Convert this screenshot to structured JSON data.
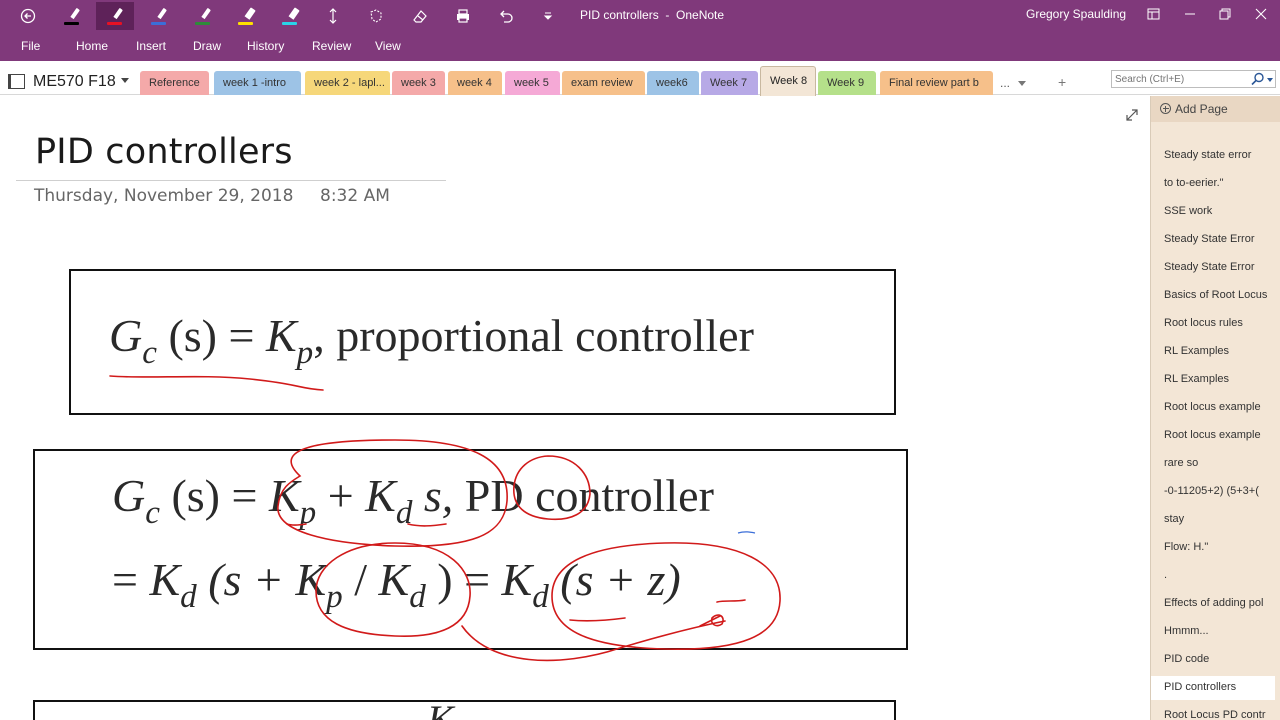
{
  "titlebar": {
    "window_title": "PID controllers  -  OneNote",
    "user_name": "Gregory Spaulding",
    "pen_colors": [
      "#000000",
      "#e81123",
      "#3b6ed8",
      "#2e8b3a",
      "#ffe000",
      "#2ad3e8"
    ],
    "icons": [
      "back-icon",
      "pen-black-icon",
      "pen-red-icon",
      "pen-blue-icon",
      "pen-green-icon",
      "highlighter-yellow-icon",
      "highlighter-cyan-icon",
      "add-space-icon",
      "lasso-select-icon",
      "eraser-icon",
      "print-icon",
      "undo-icon",
      "customize-toolbar-icon"
    ],
    "window_controls": [
      "full-screen-icon",
      "minimize-icon",
      "restore-icon",
      "close-icon"
    ]
  },
  "ribbon": {
    "menus": [
      "File",
      "Home",
      "Insert",
      "Draw",
      "History",
      "Review",
      "View"
    ]
  },
  "notebook": {
    "name": "ME570 F18",
    "section_tabs": [
      {
        "label": "Reference",
        "color": "#f4a9a9"
      },
      {
        "label": "week 1 -intro",
        "color": "#9dc3e6"
      },
      {
        "label": "week 2 - lapl...",
        "color": "#f6d77a"
      },
      {
        "label": "week 3",
        "color": "#f4a9a9"
      },
      {
        "label": "week 4",
        "color": "#f6c08a"
      },
      {
        "label": "week 5",
        "color": "#f5a9d6"
      },
      {
        "label": "exam review",
        "color": "#f6c08a"
      },
      {
        "label": "week6",
        "color": "#9dc3e6"
      },
      {
        "label": "Week 7",
        "color": "#b7a9e6"
      },
      {
        "label": "Week 8",
        "color": "#f3e6d6"
      },
      {
        "label": "Week 9",
        "color": "#b5e08a"
      },
      {
        "label": "Final review part b",
        "color": "#f6c08a"
      }
    ],
    "more_label": "...",
    "add_label": "+",
    "search_placeholder": "Search (Ctrl+E)"
  },
  "page": {
    "title": "PID controllers",
    "date": "Thursday, November 29, 2018",
    "time": "8:32 AM",
    "eq1": {
      "G": "G",
      "c": "c",
      "s": "(s)",
      "eq": "=",
      "K": "K",
      "p": "p",
      "rest": ", proportional controller"
    },
    "eq2_line1": {
      "G": "G",
      "c": "c",
      "s": "(s)",
      "eq": "=",
      "K1": "K",
      "p": "p",
      "plus": "+",
      "K2": "K",
      "d": "d",
      "s2": "s,",
      "label": "PD controller"
    },
    "eq2_line2": {
      "eq": "=",
      "K1": "K",
      "d1": "d",
      "open": "(s +",
      "K2": "K",
      "p": "p",
      "slash": "/",
      "K3": "K",
      "d2": "d",
      "close": ") =",
      "K4": "K",
      "d3": "d",
      "last": "(s + z)"
    },
    "eq3_partial": "K"
  },
  "pagelist": {
    "add_page_label": "Add Page",
    "pages": [
      "Steady state error",
      "to to-eerier.\"",
      "SSE work",
      "Steady State Error",
      "Steady State Error",
      "Basics of Root Locus",
      "Root locus rules",
      "RL Examples",
      "RL Examples",
      "Root locus example",
      "Root locus example",
      "rare so",
      "-0-11205+2)  (5+3+(",
      "stay",
      "Flow: H.\"",
      ".",
      "Effects of adding pol",
      "Hmmm...",
      "PID code",
      "PID controllers",
      "Root Locus PD contr"
    ],
    "selected_index": 19
  },
  "colors": {
    "brand": "#80397B",
    "ink": "#d11a1a",
    "page_list": "#f3e6d6"
  }
}
